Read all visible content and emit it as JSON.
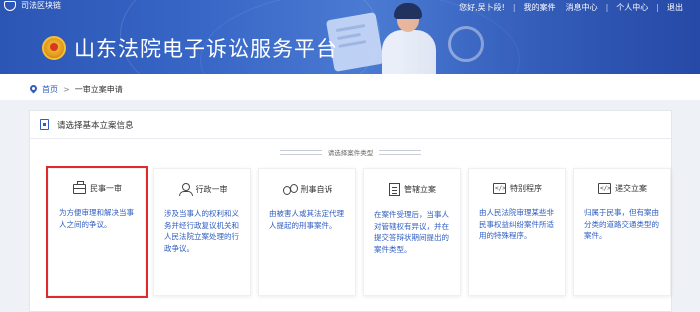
{
  "header": {
    "top_logo_text": "司法区块链",
    "greeting": "您好,吴卜段!",
    "links": [
      "我的案件",
      "消息中心",
      "个人中心",
      "退出"
    ],
    "site_title": "山东法院电子诉讼服务平台"
  },
  "breadcrumb": {
    "home": "首页",
    "separator": ">",
    "current": "一审立案申请"
  },
  "panel": {
    "heading": "请选择基本立案信息",
    "divider_label": "请选择案件类型"
  },
  "cards": [
    {
      "icon": "briefcase-icon",
      "title": "民事一审",
      "desc": "为方便审理和解决当事人之间的争议。",
      "selected": true
    },
    {
      "icon": "person-icon",
      "title": "行政一审",
      "desc": "涉及当事人的权利和义务并经行政复议机关和人民法院立案处理的行政争议。",
      "selected": false
    },
    {
      "icon": "handcuffs-icon",
      "title": "刑事自诉",
      "desc": "由被害人或其法定代理人提起的刑事案件。",
      "selected": false
    },
    {
      "icon": "list-icon",
      "title": "管辖立案",
      "desc": "在案件受理后，当事人对管辖权有异议，并在提交答辩状期间提出的案件类型。",
      "selected": false
    },
    {
      "icon": "code-icon",
      "title": "特别程序",
      "desc": "由人民法院审理某些非民事权益纠纷案件所适用的特殊程序。",
      "selected": false
    },
    {
      "icon": "code-icon",
      "title": "递交立案",
      "desc": "归属于民事，但有案由分类的道路交通类型的案件。",
      "selected": false
    }
  ],
  "colors": {
    "brand_blue": "#2f5cc0",
    "selected_border": "#e0292b",
    "banner_blue": "#3766c6"
  }
}
